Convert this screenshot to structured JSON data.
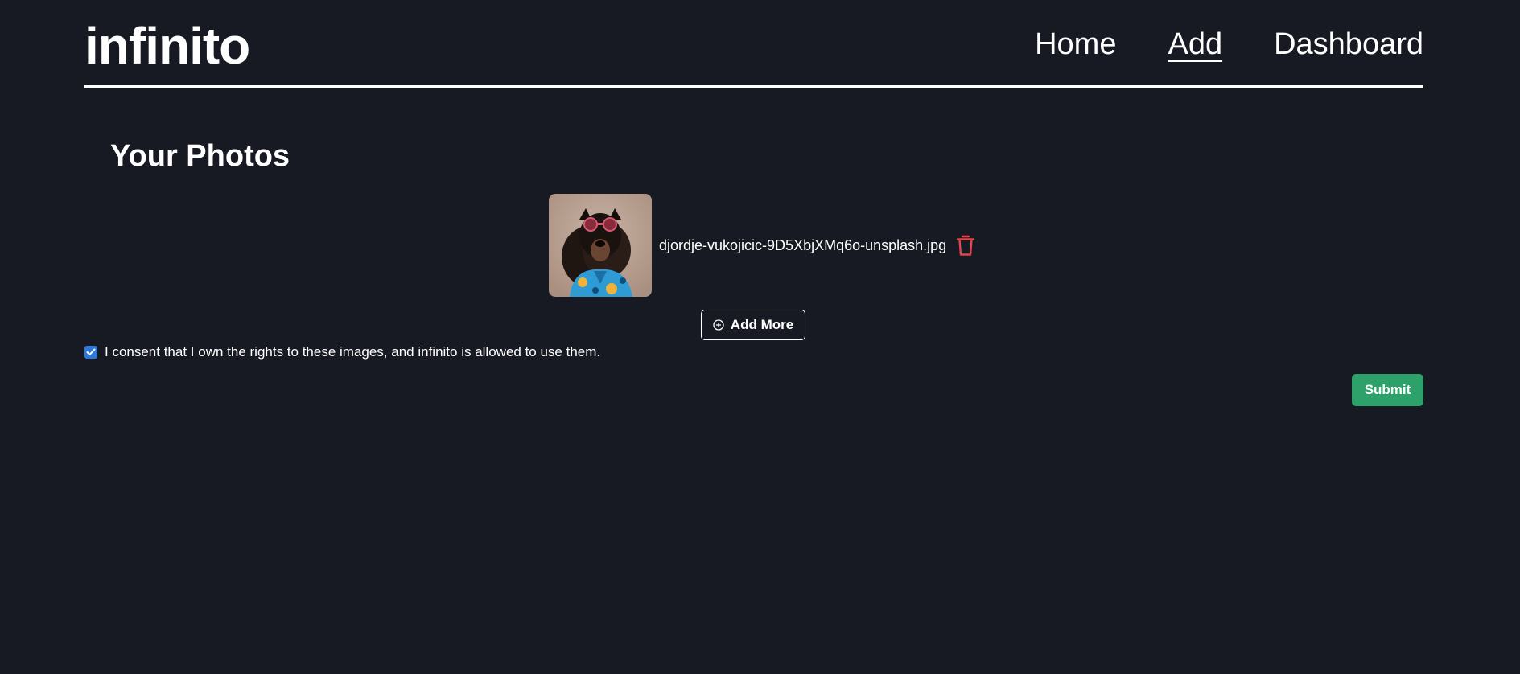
{
  "header": {
    "brand": "infinito",
    "nav": [
      {
        "label": "Home",
        "active": false
      },
      {
        "label": "Add",
        "active": true
      },
      {
        "label": "Dashboard",
        "active": false
      }
    ]
  },
  "main": {
    "title": "Your Photos",
    "photos": [
      {
        "filename": "djordje-vukojicic-9D5XbjXMq6o-unsplash.jpg",
        "thumbnail_alt": "dog wearing sunglasses and blue floral shirt"
      }
    ],
    "delete_icon": "trash-icon",
    "add_more_icon": "plus-circle-icon",
    "add_more_label": "Add More",
    "consent": {
      "checked": true,
      "label": "I consent that I own the rights to these images, and infinito is allowed to use them."
    },
    "submit_label": "Submit"
  },
  "colors": {
    "background": "#181a23",
    "text": "#ffffff",
    "delete": "#e0454a",
    "checkbox": "#2f7ad9",
    "submit": "#2ea069"
  }
}
